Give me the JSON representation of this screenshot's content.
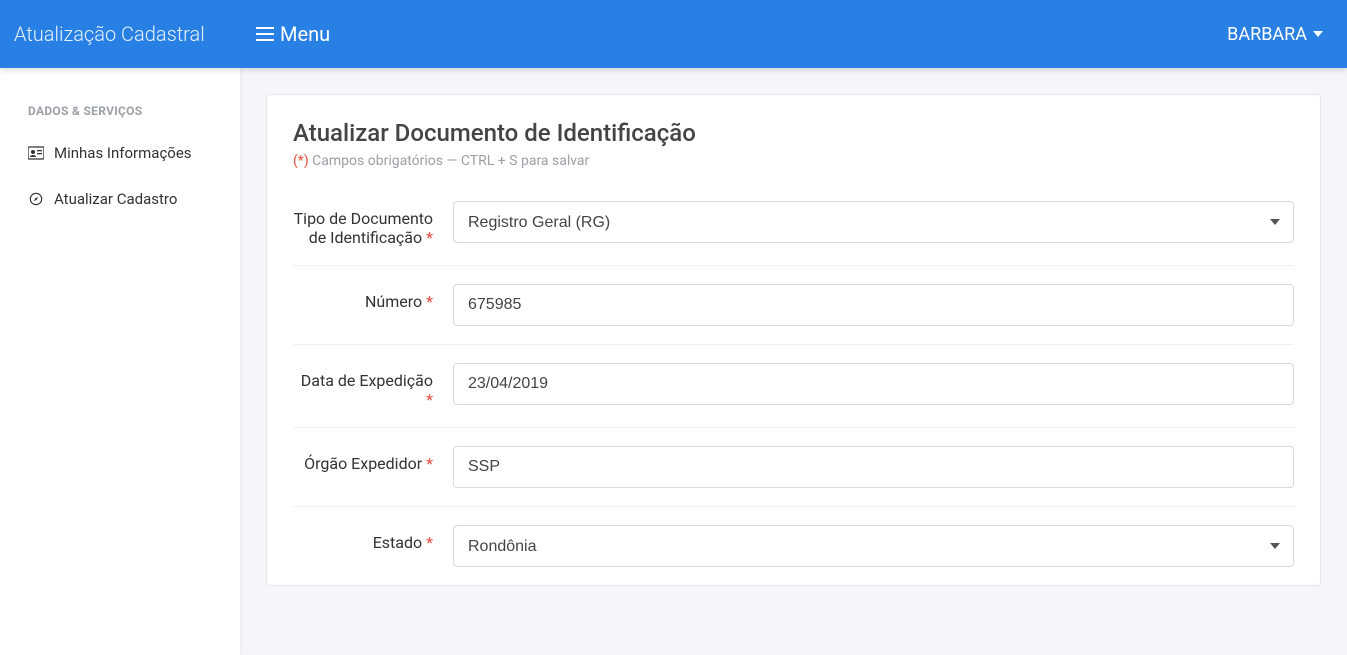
{
  "header": {
    "brand": "Atualização Cadastral",
    "menu_label": "Menu",
    "user_name": "BARBARA"
  },
  "sidebar": {
    "heading": "DADOS & SERVIÇOS",
    "items": [
      {
        "label": "Minhas Informações"
      },
      {
        "label": "Atualizar Cadastro"
      }
    ]
  },
  "page": {
    "title": "Atualizar Documento de Identificação",
    "hint_asterisk": "(*)",
    "hint_text": " Campos obrigatórios — CTRL + S para salvar"
  },
  "form": {
    "doc_type": {
      "label": "Tipo de Documento de Identificação",
      "value": "Registro Geral (RG)"
    },
    "numero": {
      "label": "Número",
      "value": "675985"
    },
    "data_expedicao": {
      "label": "Data de Expedição",
      "value": "23/04/2019"
    },
    "orgao_expedidor": {
      "label": "Órgão Expedidor",
      "value": "SSP"
    },
    "estado": {
      "label": "Estado",
      "value": "Rondônia"
    }
  }
}
